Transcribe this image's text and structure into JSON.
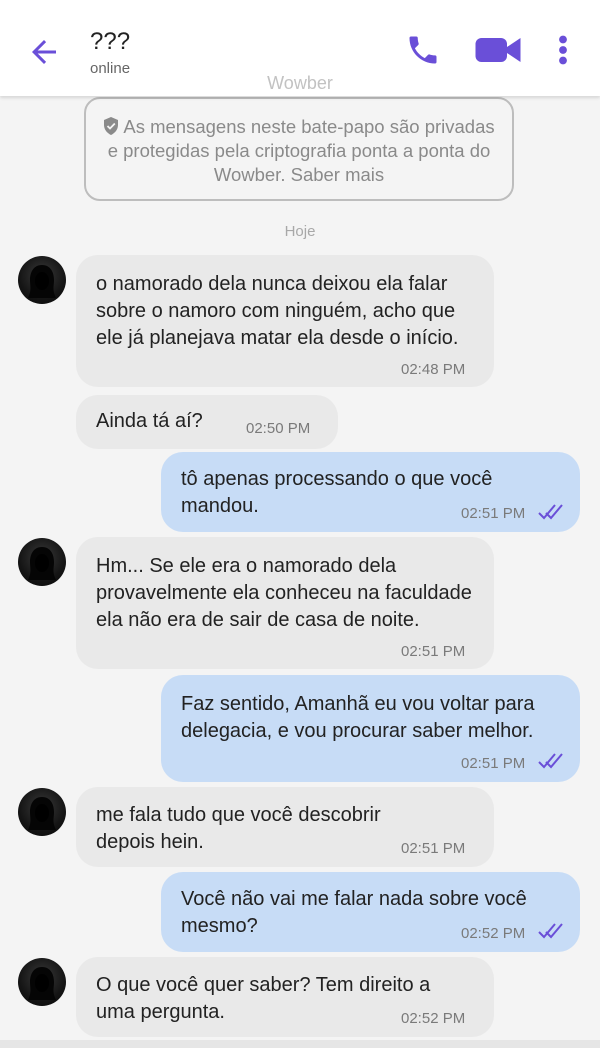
{
  "header": {
    "title": "???",
    "status": "online",
    "watermark": "Wowber"
  },
  "banner": {
    "text": "As mensagens neste bate-papo são privadas e protegidas pela criptografia ponta a ponta do Wowber. Saber mais"
  },
  "day_label": "Hoje",
  "messages": [
    {
      "dir": "in",
      "text": "o namorado dela nunca deixou ela falar sobre o namoro com ninguém, acho que ele já planejava matar ela desde o início.",
      "time": "02:48 PM"
    },
    {
      "dir": "in",
      "text": "Ainda tá aí?",
      "time": "02:50 PM"
    },
    {
      "dir": "out",
      "text": "tô apenas processando o que você mandou.",
      "time": "02:51 PM"
    },
    {
      "dir": "in",
      "text": "Hm... Se ele era o namorado dela provavelmente ela conheceu na faculdade ela não era de sair de casa de noite.",
      "time": "02:51 PM"
    },
    {
      "dir": "out",
      "text": "Faz sentido, Amanhã eu vou voltar para delegacia, e vou procurar saber melhor.",
      "time": "02:51 PM"
    },
    {
      "dir": "in",
      "text": "me fala tudo que você descobrir depois hein.",
      "time": "02:51 PM"
    },
    {
      "dir": "out",
      "text": "Você não vai me falar nada sobre você mesmo?",
      "time": "02:52 PM"
    },
    {
      "dir": "in",
      "text": "O que você quer saber? Tem direito a uma pergunta.",
      "time": "02:52 PM"
    }
  ],
  "colors": {
    "accent": "#6a4fd8",
    "incoming_bubble": "#e9e9e9",
    "outgoing_bubble": "#c7dcf6",
    "background": "#f4f4f4"
  },
  "icons": {
    "back": "arrow-left-icon",
    "call": "phone-icon",
    "video": "video-camera-icon",
    "more": "more-vertical-icon",
    "shield": "shield-check-icon",
    "read": "double-check-icon"
  }
}
